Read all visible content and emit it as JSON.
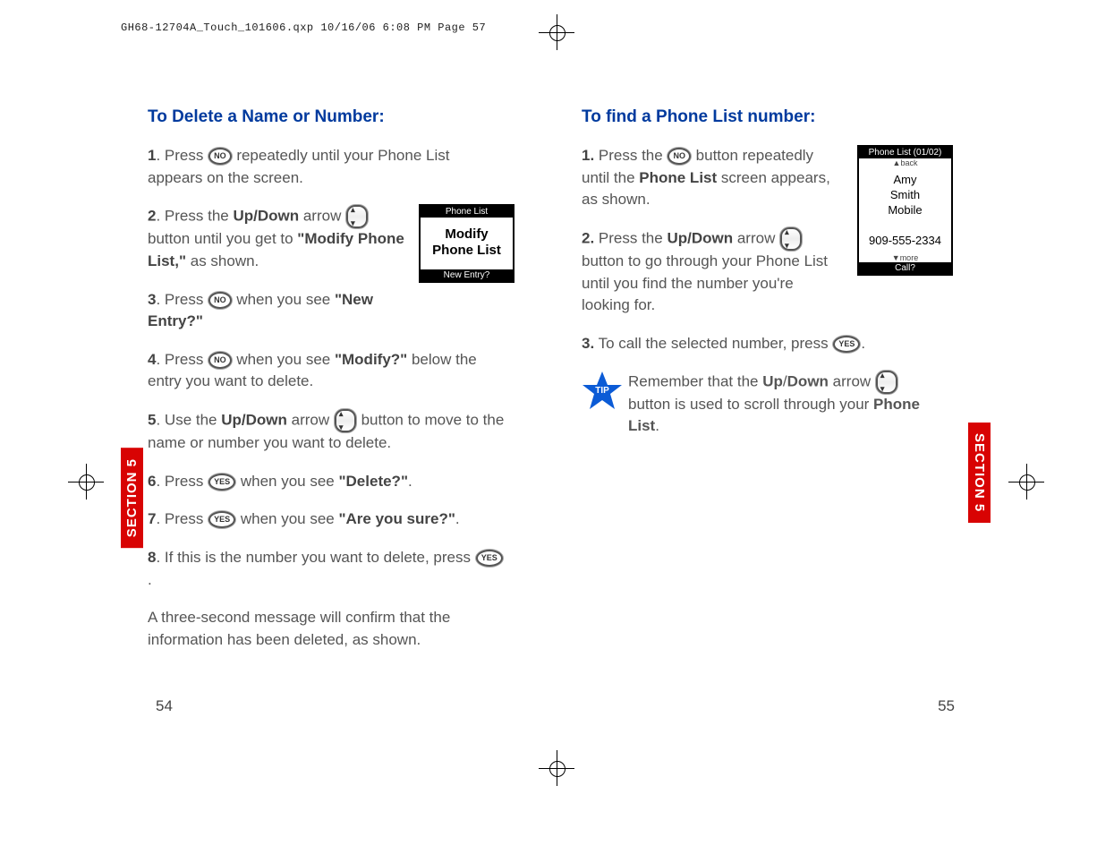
{
  "slug": "GH68-12704A_Touch_101606.qxp  10/16/06  6:08 PM  Page 57",
  "section_label": "SECTION 5",
  "page_left": "54",
  "page_right": "55",
  "left": {
    "heading": "To Delete a Name or Number:",
    "s1_a": "1",
    "s1_b": ". Press ",
    "s1_c": " repeatedly until your Phone List appears on the screen.",
    "s2_a": "2",
    "s2_b": ". Press the ",
    "s2_bold1": "Up/Down",
    "s2_c": " arrow ",
    "s2_d": " button until you get to ",
    "s2_bold2": "\"Modify Phone List,\"",
    "s2_e": " as shown.",
    "s3_a": "3",
    "s3_b": ". Press ",
    "s3_c": " when you see ",
    "s3_bold": "\"New Entry?\"",
    "s4_a": "4",
    "s4_b": ". Press ",
    "s4_c": " when you see ",
    "s4_bold": "\"Modify?\"",
    "s4_d": " below the entry you want to delete.",
    "s5_a": "5",
    "s5_b": ". Use the ",
    "s5_bold": "Up/Down",
    "s5_c": " arrow ",
    "s5_d": " button to move to the name or number you want to delete.",
    "s6_a": "6",
    "s6_b": ". Press ",
    "s6_c": " when you see ",
    "s6_bold": "\"Delete?\"",
    "s6_d": ".",
    "s7_a": "7",
    "s7_b": ". Press ",
    "s7_c": " when you see ",
    "s7_bold": "\"Are you sure?\"",
    "s7_d": ".",
    "s8_a": "8",
    "s8_b": ". If this is the number you want to delete, press ",
    "s8_c": ".",
    "closing": "A three-second message will confirm that the information has been deleted, as shown.",
    "screen1": {
      "top": "Phone List",
      "body": "Modify Phone List",
      "bot": "New Entry?"
    }
  },
  "right": {
    "heading": "To find a Phone List number:",
    "s1_a": "1.",
    "s1_b": " Press the ",
    "s1_c": " button repeatedly until the ",
    "s1_bold": "Phone List",
    "s1_d": " screen appears, as shown.",
    "s2_a": "2.",
    "s2_b": " Press the ",
    "s2_bold": "Up/Down",
    "s2_c": " arrow ",
    "s2_d": " button to go through your Phone List until you find the number you're looking for.",
    "s3_a": "3.",
    "s3_b": " To call the selected number, press ",
    "s3_c": ".",
    "tip_label": "TIP",
    "tip_a": "Remember that the ",
    "tip_bold1": "Up",
    "tip_slash": "/",
    "tip_bold2": "Down",
    "tip_b": " arrow ",
    "tip_c": " button is used to scroll through your ",
    "tip_bold3": "Phone List",
    "tip_d": ".",
    "screen2": {
      "top": "Phone List (01/02)",
      "back": "▲back",
      "l1": "Amy",
      "l2": "Smith",
      "l3": "Mobile",
      "num": "909-555-2334",
      "more": "▼more",
      "bot": "Call?"
    }
  },
  "btn": {
    "no": "NO",
    "yes": "YES"
  }
}
